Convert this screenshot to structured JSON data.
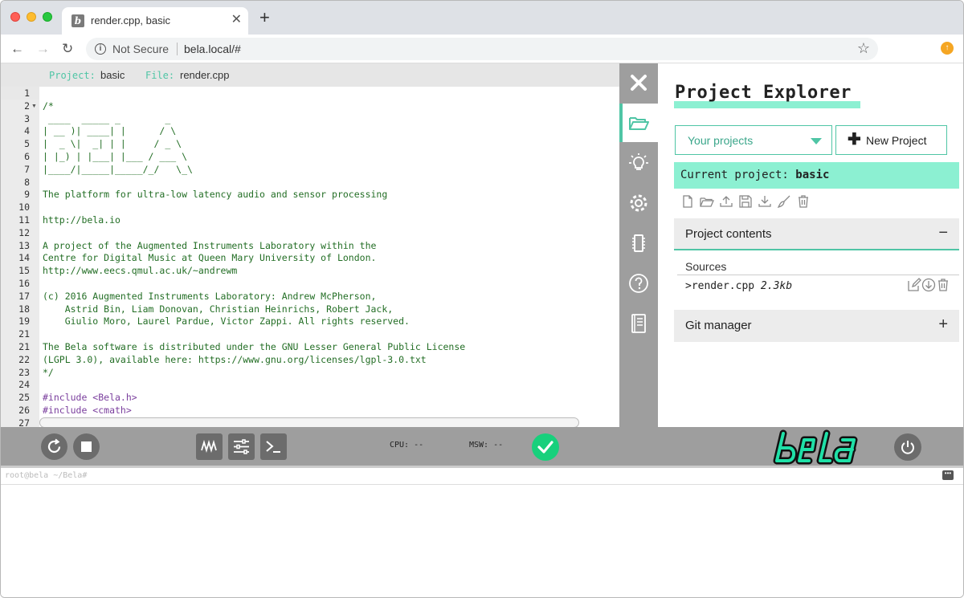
{
  "browser": {
    "tab_title": "render.cpp, basic",
    "new_tab": "+",
    "not_secure": "Not Secure",
    "url": "bela.local/#"
  },
  "editor": {
    "project_label": "Project:",
    "project_name": "basic",
    "file_label": "File:",
    "file_name": "render.cpp",
    "lines": [
      {
        "n": "1",
        "t": "",
        "k": "c"
      },
      {
        "n": "2",
        "t": "/*",
        "k": "c",
        "fold": true
      },
      {
        "n": "3",
        "t": " ____  _____ _        _",
        "k": "c"
      },
      {
        "n": "4",
        "t": "| __ )| ____| |      / \\",
        "k": "c"
      },
      {
        "n": "5",
        "t": "|  _ \\|  _| | |     / _ \\",
        "k": "c"
      },
      {
        "n": "6",
        "t": "| |_) | |___| |___ / ___ \\",
        "k": "c"
      },
      {
        "n": "7",
        "t": "|____/|_____|_____/_/   \\_\\",
        "k": "c"
      },
      {
        "n": "8",
        "t": "",
        "k": "c"
      },
      {
        "n": "9",
        "t": "The platform for ultra-low latency audio and sensor processing",
        "k": "c"
      },
      {
        "n": "10",
        "t": "",
        "k": "c"
      },
      {
        "n": "11",
        "t": "http://bela.io",
        "k": "c"
      },
      {
        "n": "12",
        "t": "",
        "k": "c"
      },
      {
        "n": "13",
        "t": "A project of the Augmented Instruments Laboratory within the",
        "k": "c"
      },
      {
        "n": "14",
        "t": "Centre for Digital Music at Queen Mary University of London.",
        "k": "c"
      },
      {
        "n": "15",
        "t": "http://www.eecs.qmul.ac.uk/~andrewm",
        "k": "c"
      },
      {
        "n": "16",
        "t": "",
        "k": "c"
      },
      {
        "n": "17",
        "t": "(c) 2016 Augmented Instruments Laboratory: Andrew McPherson,",
        "k": "c"
      },
      {
        "n": "18",
        "t": "    Astrid Bin, Liam Donovan, Christian Heinrichs, Robert Jack,",
        "k": "c"
      },
      {
        "n": "19",
        "t": "    Giulio Moro, Laurel Pardue, Victor Zappi. All rights reserved.",
        "k": "c"
      },
      {
        "n": "21",
        "t": "",
        "k": "c"
      },
      {
        "n": "21",
        "t": "The Bela software is distributed under the GNU Lesser General Public License",
        "k": "c"
      },
      {
        "n": "22",
        "t": "(LGPL 3.0), available here: https://www.gnu.org/licenses/lgpl-3.0.txt",
        "k": "c"
      },
      {
        "n": "23",
        "t": "*/",
        "k": "c"
      },
      {
        "n": "24",
        "t": "",
        "k": "c"
      },
      {
        "n": "25",
        "t": "#include <Bela.h>",
        "k": "pp"
      },
      {
        "n": "26",
        "t": "#include <cmath>",
        "k": "pp"
      },
      {
        "n": "27",
        "t": "",
        "k": "c"
      }
    ]
  },
  "explorer": {
    "title": "Project Explorer",
    "select_label": "Your projects",
    "new_project": "New Project",
    "current_label": "Current project:",
    "current_name": "basic",
    "contents_label": "Project contents",
    "contents_toggle": "−",
    "sources_label": "Sources",
    "file_name": ">render.cpp",
    "file_size": "2.3kb",
    "git_label": "Git manager",
    "git_toggle": "+"
  },
  "toolbar": {
    "cpu": "CPU: --",
    "msw": "MSW: --"
  },
  "console": {
    "prompt": "root@bela ~/Bela#"
  },
  "colors": {
    "accent": "#4fc5a5",
    "accent_light": "#8cf0d2",
    "toolbar_gray": "#9e9e9e",
    "build_ok": "#18d07c"
  }
}
